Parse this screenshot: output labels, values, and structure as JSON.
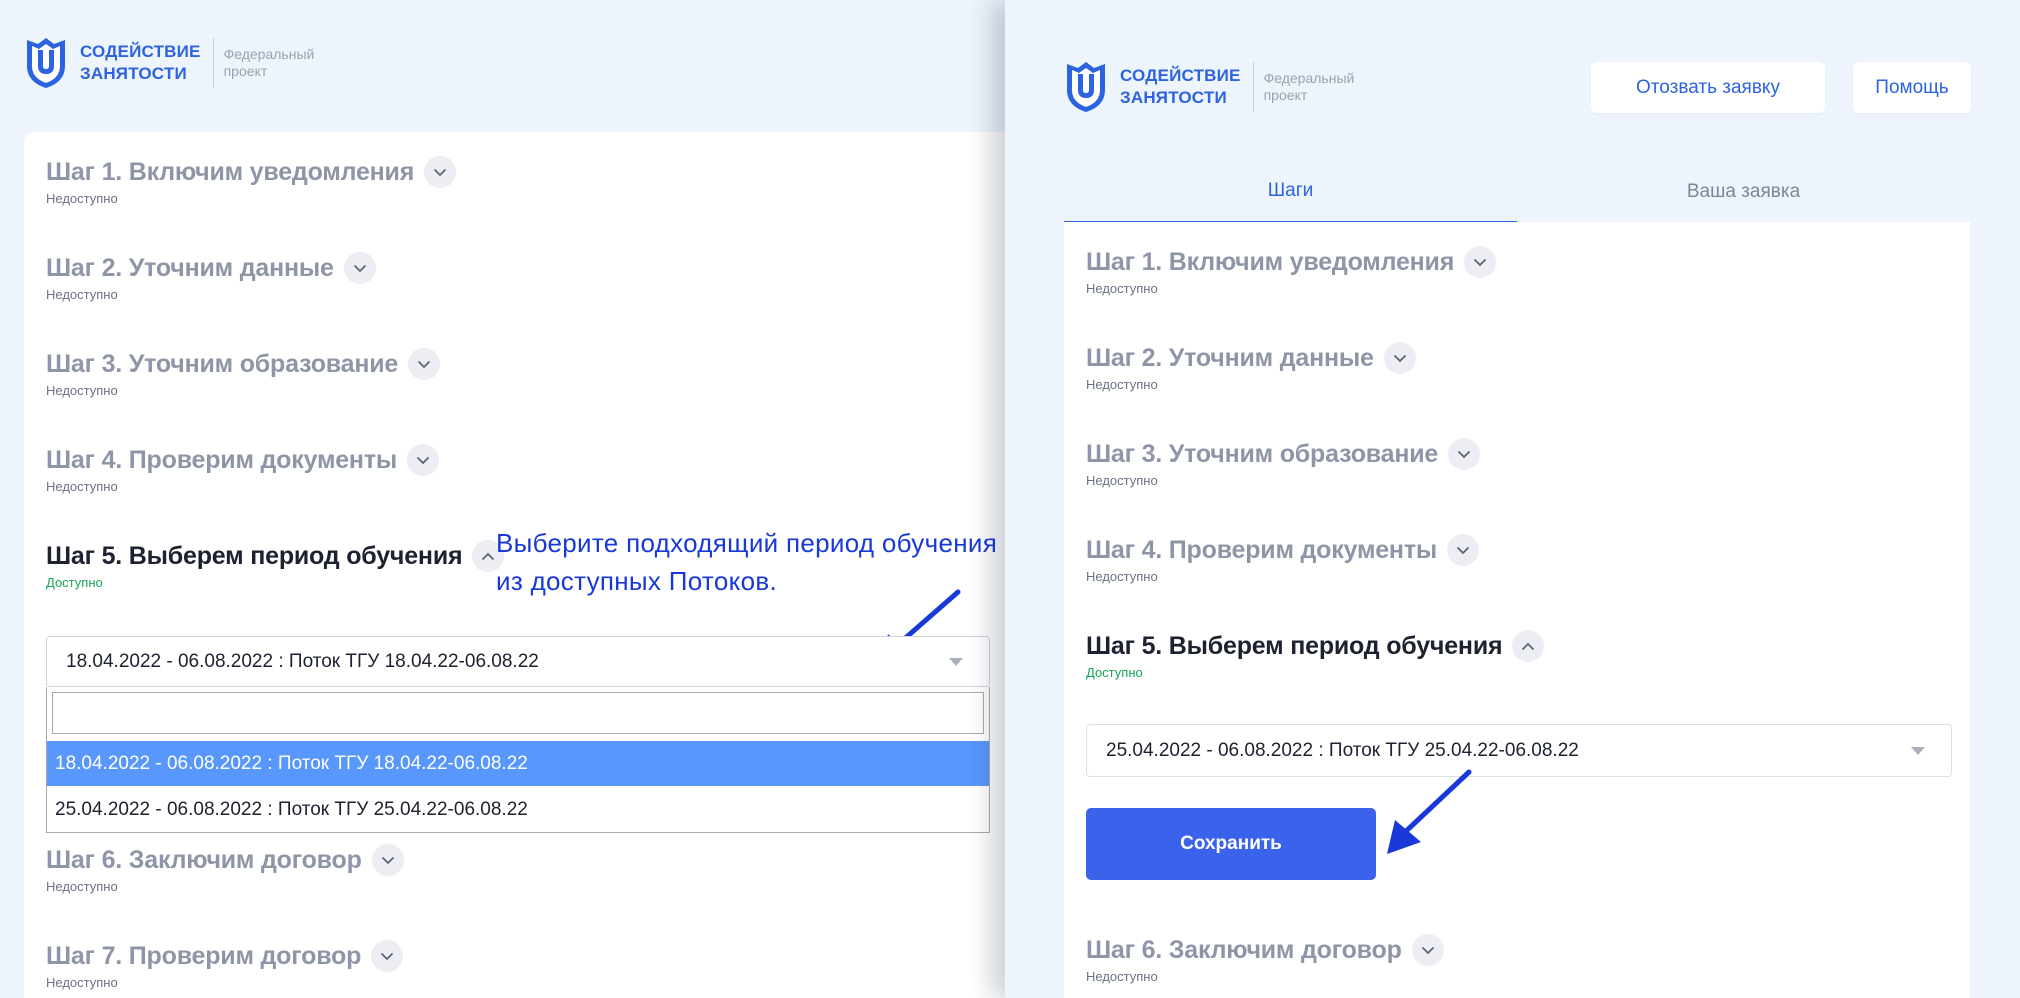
{
  "brand": {
    "name_line1": "СОДЕЙСТВИЕ",
    "name_line2": "ЗАНЯТОСТИ",
    "sub_line1": "Федеральный",
    "sub_line2": "проект"
  },
  "colors": {
    "accent": "#2c63e0",
    "status_available": "#18a557",
    "hint": "#1838d8",
    "highlight": "#5897fb",
    "save_button": "#3a62ea"
  },
  "left_panel": {
    "steps": [
      {
        "title": "Шаг 1. Включим уведомления",
        "status": "Недоступно"
      },
      {
        "title": "Шаг 2. Уточним данные",
        "status": "Недоступно"
      },
      {
        "title": "Шаг 3. Уточним образование",
        "status": "Недоступно"
      },
      {
        "title": "Шаг 4. Проверим документы",
        "status": "Недоступно"
      },
      {
        "title": "Шаг 5. Выберем период обучения",
        "status": "Доступно"
      },
      {
        "title": "Шаг 6. Заключим договор",
        "status": "Недоступно"
      },
      {
        "title": "Шаг 7. Проверим договор",
        "status": "Недоступно"
      }
    ],
    "select_value": "18.04.2022 - 06.08.2022 : Поток ТГУ 18.04.22-06.08.22",
    "options": [
      "18.04.2022 - 06.08.2022 : Поток ТГУ 18.04.22-06.08.22",
      "25.04.2022 - 06.08.2022 : Поток ТГУ 25.04.22-06.08.22"
    ],
    "hint_line1": "Выберите подходящий период обучения",
    "hint_line2": "из доступных Потоков."
  },
  "right_panel": {
    "withdraw_label": "Отозвать заявку",
    "help_label": "Помощь",
    "tabs": [
      "Шаги",
      "Ваша заявка"
    ],
    "steps": [
      {
        "title": "Шаг 1. Включим уведомления",
        "status": "Недоступно"
      },
      {
        "title": "Шаг 2. Уточним данные",
        "status": "Недоступно"
      },
      {
        "title": "Шаг 3. Уточним образование",
        "status": "Недоступно"
      },
      {
        "title": "Шаг 4. Проверим документы",
        "status": "Недоступно"
      },
      {
        "title": "Шаг 5. Выберем период обучения",
        "status": "Доступно"
      },
      {
        "title": "Шаг 6. Заключим договор",
        "status": "Недоступно"
      }
    ],
    "select_value": "25.04.2022 - 06.08.2022 : Поток ТГУ 25.04.22-06.08.22",
    "save_label": "Сохранить"
  },
  "icons": [
    "shield-logo-icon",
    "chevron-down-icon",
    "chevron-up-icon",
    "select-caret-icon",
    "pointer-arrow-icon"
  ]
}
